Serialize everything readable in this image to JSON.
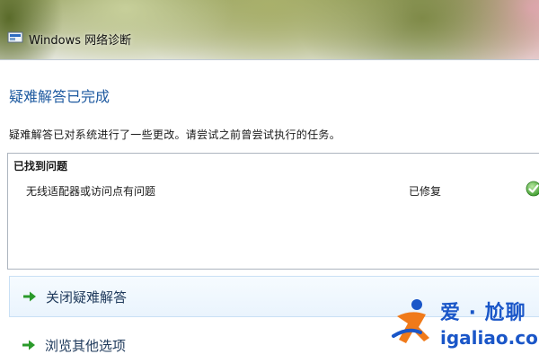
{
  "window": {
    "title": "Windows 网络诊断",
    "icon": "network-diagnostics-icon"
  },
  "heading": "疑难解答已完成",
  "description": "疑难解答已对系统进行了一些更改。请尝试之前曾尝试执行的任务。",
  "results": {
    "header": "已找到问题",
    "items": [
      {
        "problem": "无线适配器或访问点有问题",
        "status": "已修复",
        "status_icon": "check-icon"
      }
    ]
  },
  "actions": {
    "close_label": "关闭疑难解答",
    "browse_label": "浏览其他选项",
    "arrow_icon": "green-arrow-icon"
  },
  "watermark": {
    "brand": "爱 · 尬聊",
    "url": "igaliao.com"
  },
  "colors": {
    "heading": "#1e5aa0",
    "arrow": "#2a9a2a",
    "check": "#3a9a2a",
    "watermark": "#1a56c8"
  }
}
